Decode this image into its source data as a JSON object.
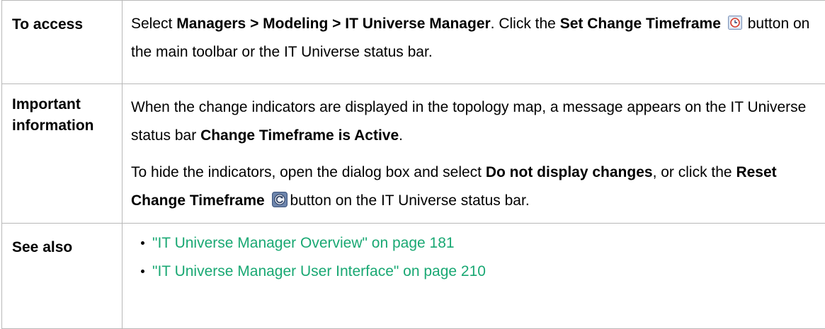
{
  "rows": {
    "access": {
      "label": "To access",
      "t1": "Select ",
      "b1": "Managers > Modeling > IT Universe Manager",
      "t2": ". Click the ",
      "b2": "Set Change Timeframe",
      "icon": "clock-icon",
      "t3": "button on the main toolbar or the IT Universe status bar."
    },
    "important": {
      "label1": "Important",
      "label2": "information",
      "p1_t1": "When the change indicators are displayed in the topology map, a message appears on the IT Universe status bar ",
      "p1_b1": "Change Timeframe is Active",
      "p1_t2": ".",
      "p2_t1": "To hide the indicators, open the dialog box and select ",
      "p2_b1": "Do not display changes",
      "p2_t2": ", or click the ",
      "p2_b2": "Reset Change Timeframe",
      "icon": "reset-icon",
      "p2_t3": "button on the IT Universe status bar."
    },
    "see_also": {
      "label": "See also",
      "links": [
        "\"IT Universe Manager Overview\" on page 181",
        "\"IT Universe Manager User Interface\" on page 210"
      ]
    }
  },
  "colors": {
    "link": "#19a873",
    "border": "#b8b8b8"
  }
}
